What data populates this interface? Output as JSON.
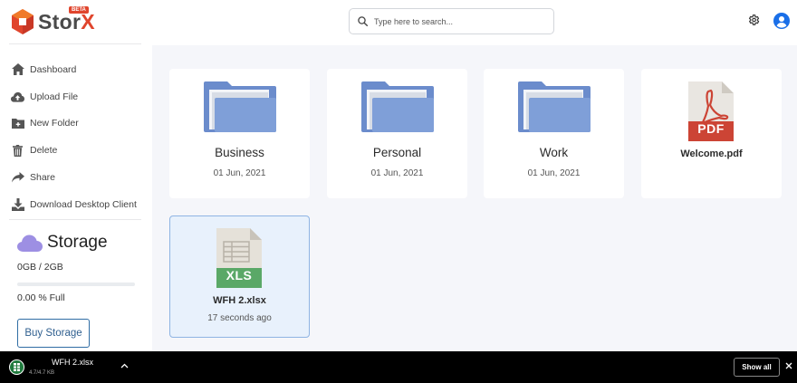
{
  "brand": {
    "name_main": "Stor",
    "name_accent": "X",
    "badge": "BETA",
    "colors": {
      "orange": "#e0452d",
      "gray": "#4a4a4a"
    }
  },
  "sidebar": {
    "items": [
      {
        "label": "Dashboard",
        "icon": "home-icon"
      },
      {
        "label": "Upload File",
        "icon": "cloud-upload-icon"
      },
      {
        "label": "New Folder",
        "icon": "folder-plus-icon"
      },
      {
        "label": "Delete",
        "icon": "trash-icon"
      },
      {
        "label": "Share",
        "icon": "share-icon"
      },
      {
        "label": "Download Desktop Client",
        "icon": "download-icon"
      }
    ],
    "storage": {
      "title": "Storage",
      "used": "0GB / 2GB",
      "percent": "0.00 % Full",
      "fill_fraction": 0.0,
      "buy_label": "Buy Storage"
    }
  },
  "header": {
    "search_placeholder": "Type here to search...",
    "icons": [
      "search-icon",
      "gear-icon",
      "user-avatar-icon"
    ]
  },
  "items": [
    {
      "type": "folder",
      "name": "Business",
      "date": "01 Jun, 2021"
    },
    {
      "type": "folder",
      "name": "Personal",
      "date": "01 Jun, 2021"
    },
    {
      "type": "folder",
      "name": "Work",
      "date": "01 Jun, 2021"
    },
    {
      "type": "pdf",
      "name": "Welcome.pdf",
      "badge": "PDF"
    },
    {
      "type": "xlsx",
      "name": "WFH 2.xlsx",
      "date": "17 seconds ago",
      "badge": "XLS",
      "selected": true
    }
  ],
  "download_bar": {
    "file_name": "WFH 2.xlsx",
    "size": "4.7/4.7 KB",
    "show_all": "Show all"
  },
  "colors": {
    "folder": "#7f9fd8",
    "accent": "#0d6efd",
    "pdf_red": "#cc4435",
    "xls_green": "#5aa867"
  }
}
